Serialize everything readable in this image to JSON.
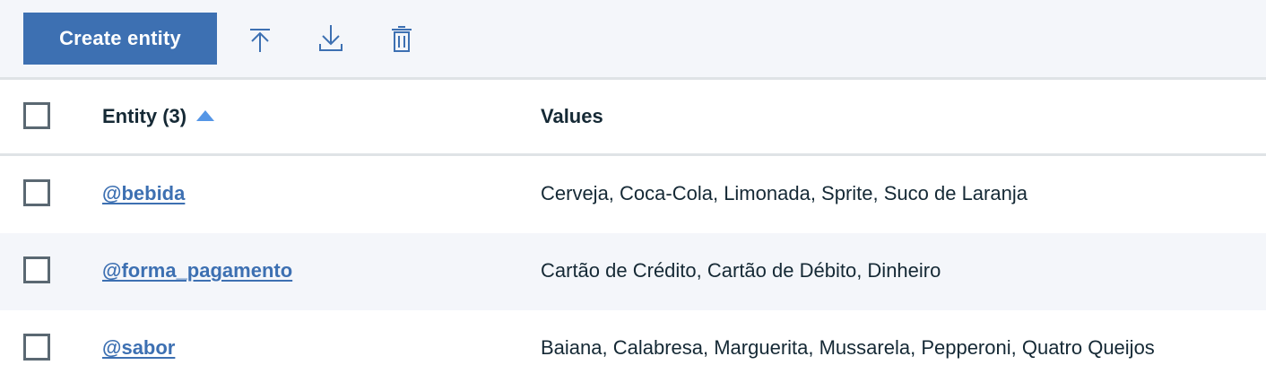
{
  "toolbar": {
    "create_label": "Create entity",
    "icons": [
      "upload-icon",
      "download-icon",
      "trash-icon"
    ]
  },
  "table": {
    "header": {
      "entity_label": "Entity (3)",
      "values_label": "Values",
      "sort": "ascending"
    },
    "rows": [
      {
        "entity": "@bebida",
        "values": "Cerveja, Coca-Cola, Limonada, Sprite, Suco de Laranja"
      },
      {
        "entity": "@forma_pagamento",
        "values": "Cartão de Crédito, Cartão de Débito, Dinheiro"
      },
      {
        "entity": "@sabor",
        "values": "Baiana, Calabresa, Marguerita, Mussarela, Pepperoni, Quatro Queijos"
      }
    ]
  },
  "colors": {
    "primary": "#3d70b2",
    "toolbar_bg": "#f4f6fa",
    "text": "#152935",
    "sort_indicator": "#5596e6",
    "checkbox_border": "#5a6872"
  }
}
